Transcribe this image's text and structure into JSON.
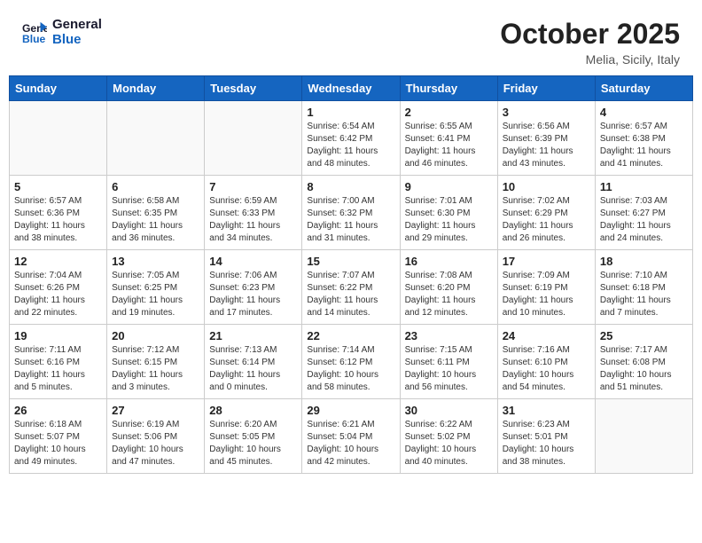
{
  "header": {
    "logo_line1": "General",
    "logo_line2": "Blue",
    "month": "October 2025",
    "location": "Melia, Sicily, Italy"
  },
  "days_of_week": [
    "Sunday",
    "Monday",
    "Tuesday",
    "Wednesday",
    "Thursday",
    "Friday",
    "Saturday"
  ],
  "weeks": [
    [
      {
        "day": "",
        "info": ""
      },
      {
        "day": "",
        "info": ""
      },
      {
        "day": "",
        "info": ""
      },
      {
        "day": "1",
        "info": "Sunrise: 6:54 AM\nSunset: 6:42 PM\nDaylight: 11 hours\nand 48 minutes."
      },
      {
        "day": "2",
        "info": "Sunrise: 6:55 AM\nSunset: 6:41 PM\nDaylight: 11 hours\nand 46 minutes."
      },
      {
        "day": "3",
        "info": "Sunrise: 6:56 AM\nSunset: 6:39 PM\nDaylight: 11 hours\nand 43 minutes."
      },
      {
        "day": "4",
        "info": "Sunrise: 6:57 AM\nSunset: 6:38 PM\nDaylight: 11 hours\nand 41 minutes."
      }
    ],
    [
      {
        "day": "5",
        "info": "Sunrise: 6:57 AM\nSunset: 6:36 PM\nDaylight: 11 hours\nand 38 minutes."
      },
      {
        "day": "6",
        "info": "Sunrise: 6:58 AM\nSunset: 6:35 PM\nDaylight: 11 hours\nand 36 minutes."
      },
      {
        "day": "7",
        "info": "Sunrise: 6:59 AM\nSunset: 6:33 PM\nDaylight: 11 hours\nand 34 minutes."
      },
      {
        "day": "8",
        "info": "Sunrise: 7:00 AM\nSunset: 6:32 PM\nDaylight: 11 hours\nand 31 minutes."
      },
      {
        "day": "9",
        "info": "Sunrise: 7:01 AM\nSunset: 6:30 PM\nDaylight: 11 hours\nand 29 minutes."
      },
      {
        "day": "10",
        "info": "Sunrise: 7:02 AM\nSunset: 6:29 PM\nDaylight: 11 hours\nand 26 minutes."
      },
      {
        "day": "11",
        "info": "Sunrise: 7:03 AM\nSunset: 6:27 PM\nDaylight: 11 hours\nand 24 minutes."
      }
    ],
    [
      {
        "day": "12",
        "info": "Sunrise: 7:04 AM\nSunset: 6:26 PM\nDaylight: 11 hours\nand 22 minutes."
      },
      {
        "day": "13",
        "info": "Sunrise: 7:05 AM\nSunset: 6:25 PM\nDaylight: 11 hours\nand 19 minutes."
      },
      {
        "day": "14",
        "info": "Sunrise: 7:06 AM\nSunset: 6:23 PM\nDaylight: 11 hours\nand 17 minutes."
      },
      {
        "day": "15",
        "info": "Sunrise: 7:07 AM\nSunset: 6:22 PM\nDaylight: 11 hours\nand 14 minutes."
      },
      {
        "day": "16",
        "info": "Sunrise: 7:08 AM\nSunset: 6:20 PM\nDaylight: 11 hours\nand 12 minutes."
      },
      {
        "day": "17",
        "info": "Sunrise: 7:09 AM\nSunset: 6:19 PM\nDaylight: 11 hours\nand 10 minutes."
      },
      {
        "day": "18",
        "info": "Sunrise: 7:10 AM\nSunset: 6:18 PM\nDaylight: 11 hours\nand 7 minutes."
      }
    ],
    [
      {
        "day": "19",
        "info": "Sunrise: 7:11 AM\nSunset: 6:16 PM\nDaylight: 11 hours\nand 5 minutes."
      },
      {
        "day": "20",
        "info": "Sunrise: 7:12 AM\nSunset: 6:15 PM\nDaylight: 11 hours\nand 3 minutes."
      },
      {
        "day": "21",
        "info": "Sunrise: 7:13 AM\nSunset: 6:14 PM\nDaylight: 11 hours\nand 0 minutes."
      },
      {
        "day": "22",
        "info": "Sunrise: 7:14 AM\nSunset: 6:12 PM\nDaylight: 10 hours\nand 58 minutes."
      },
      {
        "day": "23",
        "info": "Sunrise: 7:15 AM\nSunset: 6:11 PM\nDaylight: 10 hours\nand 56 minutes."
      },
      {
        "day": "24",
        "info": "Sunrise: 7:16 AM\nSunset: 6:10 PM\nDaylight: 10 hours\nand 54 minutes."
      },
      {
        "day": "25",
        "info": "Sunrise: 7:17 AM\nSunset: 6:08 PM\nDaylight: 10 hours\nand 51 minutes."
      }
    ],
    [
      {
        "day": "26",
        "info": "Sunrise: 6:18 AM\nSunset: 5:07 PM\nDaylight: 10 hours\nand 49 minutes."
      },
      {
        "day": "27",
        "info": "Sunrise: 6:19 AM\nSunset: 5:06 PM\nDaylight: 10 hours\nand 47 minutes."
      },
      {
        "day": "28",
        "info": "Sunrise: 6:20 AM\nSunset: 5:05 PM\nDaylight: 10 hours\nand 45 minutes."
      },
      {
        "day": "29",
        "info": "Sunrise: 6:21 AM\nSunset: 5:04 PM\nDaylight: 10 hours\nand 42 minutes."
      },
      {
        "day": "30",
        "info": "Sunrise: 6:22 AM\nSunset: 5:02 PM\nDaylight: 10 hours\nand 40 minutes."
      },
      {
        "day": "31",
        "info": "Sunrise: 6:23 AM\nSunset: 5:01 PM\nDaylight: 10 hours\nand 38 minutes."
      },
      {
        "day": "",
        "info": ""
      }
    ]
  ]
}
